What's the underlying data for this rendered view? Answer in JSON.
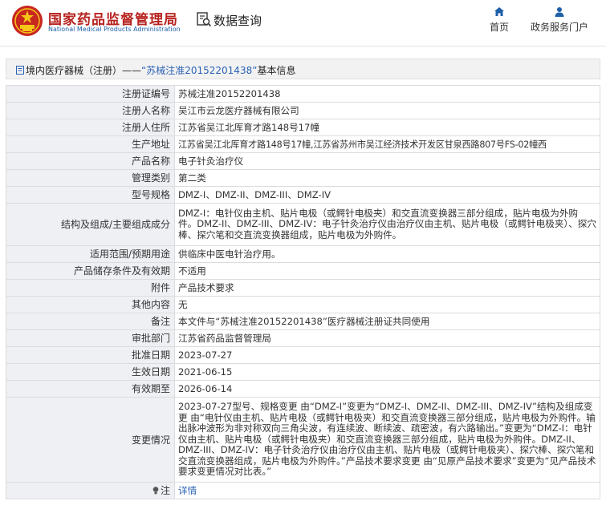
{
  "header": {
    "brand_cn": "国家药品监督管理局",
    "brand_en": "National Medical Products Administration",
    "query_label": "数据查询",
    "nav": {
      "home": "首页",
      "service": "政务服务门户"
    },
    "colors": {
      "brand_red": "#b7231f",
      "link_blue": "#2a62b6"
    }
  },
  "title": {
    "prefix": "境内医疗器械（注册）——",
    "highlight": "“苏械注准20152201438”",
    "suffix": "基本信息"
  },
  "rows": [
    {
      "label": "注册证编号",
      "value": "苏械注准20152201438"
    },
    {
      "label": "注册人名称",
      "value": "吴江市云龙医疗器械有限公司"
    },
    {
      "label": "注册人住所",
      "value": "江苏省吴江北厍育才路148号17幢"
    },
    {
      "label": "生产地址",
      "value": "江苏省吴江北厍育才路148号17幢,江苏省苏州市吴江经济技术开发区甘泉西路807号FS-02幢西"
    },
    {
      "label": "产品名称",
      "value": "电子针灸治疗仪"
    },
    {
      "label": "管理类别",
      "value": "第二类"
    },
    {
      "label": "型号规格",
      "value": "DMZ-I、DMZ-II、DMZ-III、DMZ-IV"
    },
    {
      "label": "结构及组成/主要组成成分",
      "value": "DMZ-I：电针仪由主机、贴片电极（或鳄针电极夹）和交直流变换器三部分组成，贴片电极为外购件。DMZ-II、DMZ-III、DMZ-IV：电子针灸治疗仪由治疗仪由主机、贴片电极（或鳄针电极夹）、探穴棒、探穴笔和交直流变换器组成，贴片电极为外购件。"
    },
    {
      "label": "适用范围/预期用途",
      "value": "供临床中医电针治疗用。"
    },
    {
      "label": "产品储存条件及有效期",
      "value": "不适用"
    },
    {
      "label": "附件",
      "value": "产品技术要求"
    },
    {
      "label": "其他内容",
      "value": "无"
    },
    {
      "label": "备注",
      "value": "本文件与“苏械注准20152201438”医疗器械注册证共同使用"
    },
    {
      "label": "审批部门",
      "value": "江苏省药品监督管理局"
    },
    {
      "label": "批准日期",
      "value": "2023-07-27"
    },
    {
      "label": "生效日期",
      "value": "2021-06-15"
    },
    {
      "label": "有效期至",
      "value": "2026-06-14"
    },
    {
      "label": "变更情况",
      "value": "2023-07-27型号、规格变更 由“DMZ-Ⅰ”变更为“DMZ-I、DMZ-II、DMZ-III、DMZ-IV”结构及组成变更 由“电针仪由主机、贴片电极（或鳄针电极夹）和交直流变换器三部分组成，贴片电极为外购件。输出脉冲波形为非对称双向三角尖波，有连续波、断续波、疏密波，有六路输出。”变更为“DMZ-I：电针仪由主机、贴片电极（或鳄针电极夹）和交直流变换器三部分组成，贴片电极为外购件。DMZ-II、DMZ-III、DMZ-IV：电子针灸治疗仪由治疗仪由主机、贴片电极（或鳄针电极夹）、探穴棒、探穴笔和交直流变换器组成，贴片电极为外购件。”产品技术要求变更 由“见原产品技术要求”变更为“见产品技术要求变更情况对比表。”"
    }
  ],
  "note": {
    "label": "注",
    "link": "详情",
    "icon": "lightbulb-icon"
  }
}
